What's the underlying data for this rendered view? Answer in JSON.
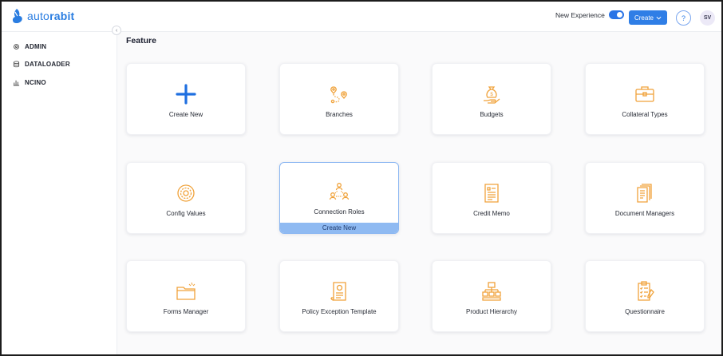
{
  "app": {
    "logo_text_light": "auto",
    "logo_text_bold": "rabit"
  },
  "header": {
    "experience_label": "New Experience",
    "experience_on": true,
    "create_label": "Create",
    "help_label": "?",
    "avatar_initials": "SV"
  },
  "sidebar": {
    "items": [
      {
        "label": "ADMIN",
        "icon": "gear-icon"
      },
      {
        "label": "DATALOADER",
        "icon": "database-icon"
      },
      {
        "label": "NCINO",
        "icon": "bar-chart-icon"
      }
    ]
  },
  "main": {
    "title": "Feature",
    "cards": [
      {
        "label": "Create New",
        "icon": "plus-icon"
      },
      {
        "label": "Branches",
        "icon": "route-pins-icon"
      },
      {
        "label": "Budgets",
        "icon": "money-bag-hand-icon"
      },
      {
        "label": "Collateral Types",
        "icon": "briefcase-icon"
      },
      {
        "label": "Config Values",
        "icon": "settings-cog-icon"
      },
      {
        "label": "Connection Roles",
        "icon": "people-network-icon",
        "hover_action": "Create New"
      },
      {
        "label": "Credit Memo",
        "icon": "memo-document-icon"
      },
      {
        "label": "Document Managers",
        "icon": "stacked-documents-icon"
      },
      {
        "label": "Forms Manager",
        "icon": "folder-icon"
      },
      {
        "label": "Policy Exception Template",
        "icon": "certificate-scroll-icon"
      },
      {
        "label": "Product Hierarchy",
        "icon": "hierarchy-boxes-icon"
      },
      {
        "label": "Questionnaire",
        "icon": "checklist-clipboard-icon"
      }
    ]
  },
  "colors": {
    "accent": "#2f7ee6",
    "icon": "#f0a23a",
    "plus": "#1f6fe0"
  }
}
